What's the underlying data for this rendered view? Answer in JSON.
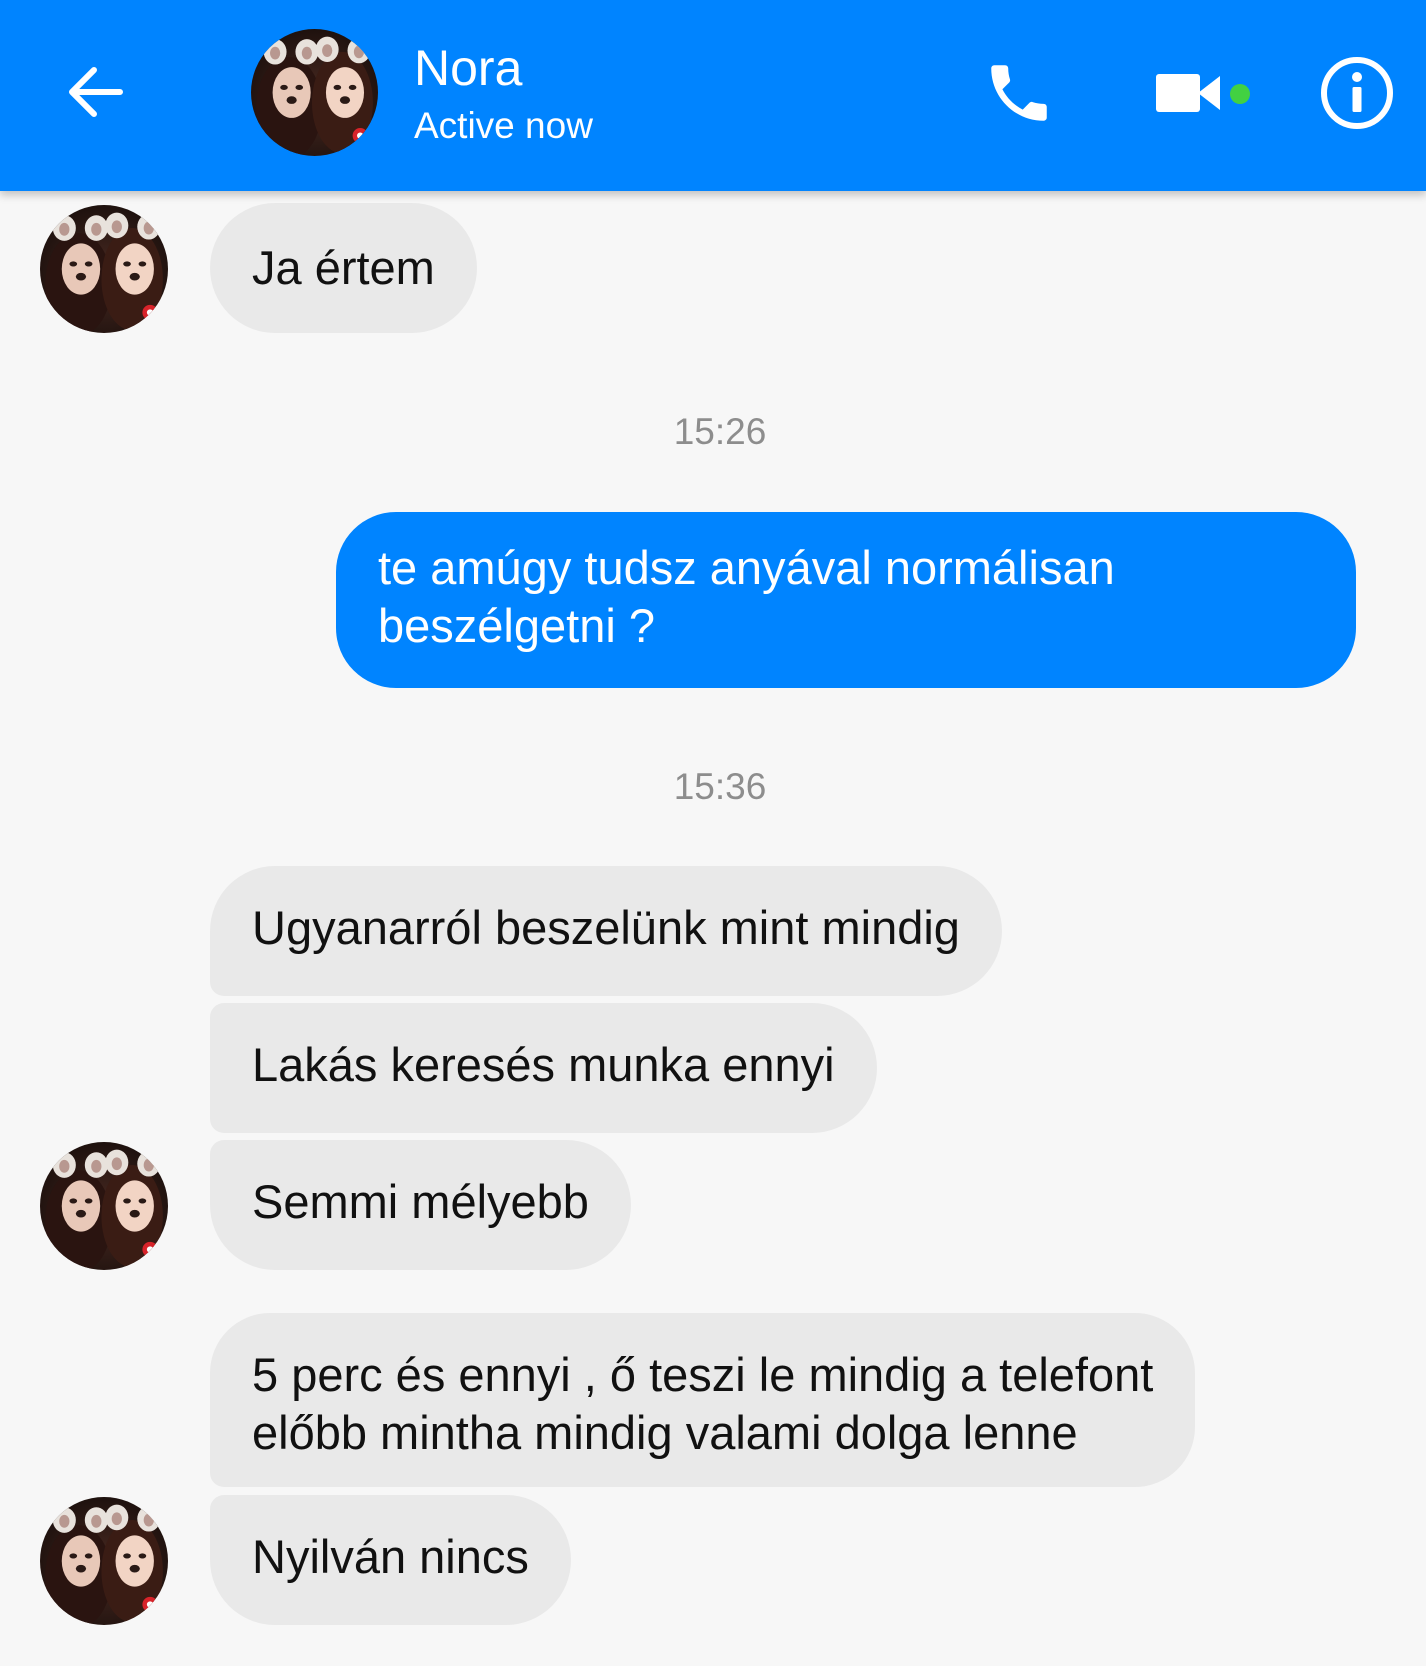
{
  "header": {
    "contact_name": "Nora",
    "status": "Active now",
    "online_color": "#42d142",
    "accent_color": "#0084ff",
    "icons": [
      "back-arrow-icon",
      "phone-icon",
      "video-camera-icon",
      "info-icon"
    ]
  },
  "messages": [
    {
      "direction": "incoming",
      "text": "Ja értem"
    },
    {
      "timestamp": "15:26"
    },
    {
      "direction": "outgoing",
      "lines": [
        "te amúgy tudsz anyával normálisan",
        "beszélgetni ?"
      ]
    },
    {
      "timestamp": "15:36"
    },
    {
      "direction": "incoming",
      "text": "Ugyanarról beszelünk mint mindig"
    },
    {
      "direction": "incoming",
      "text": "Lakás keresés munka ennyi"
    },
    {
      "direction": "incoming",
      "text": "Semmi mélyebb"
    },
    {
      "direction": "incoming",
      "lines": [
        "5 perc és ennyi , ő teszi le mindig a telefont",
        "előbb mintha mindig valami dolga lenne"
      ]
    },
    {
      "direction": "incoming",
      "text": "Nyilván nincs"
    }
  ]
}
